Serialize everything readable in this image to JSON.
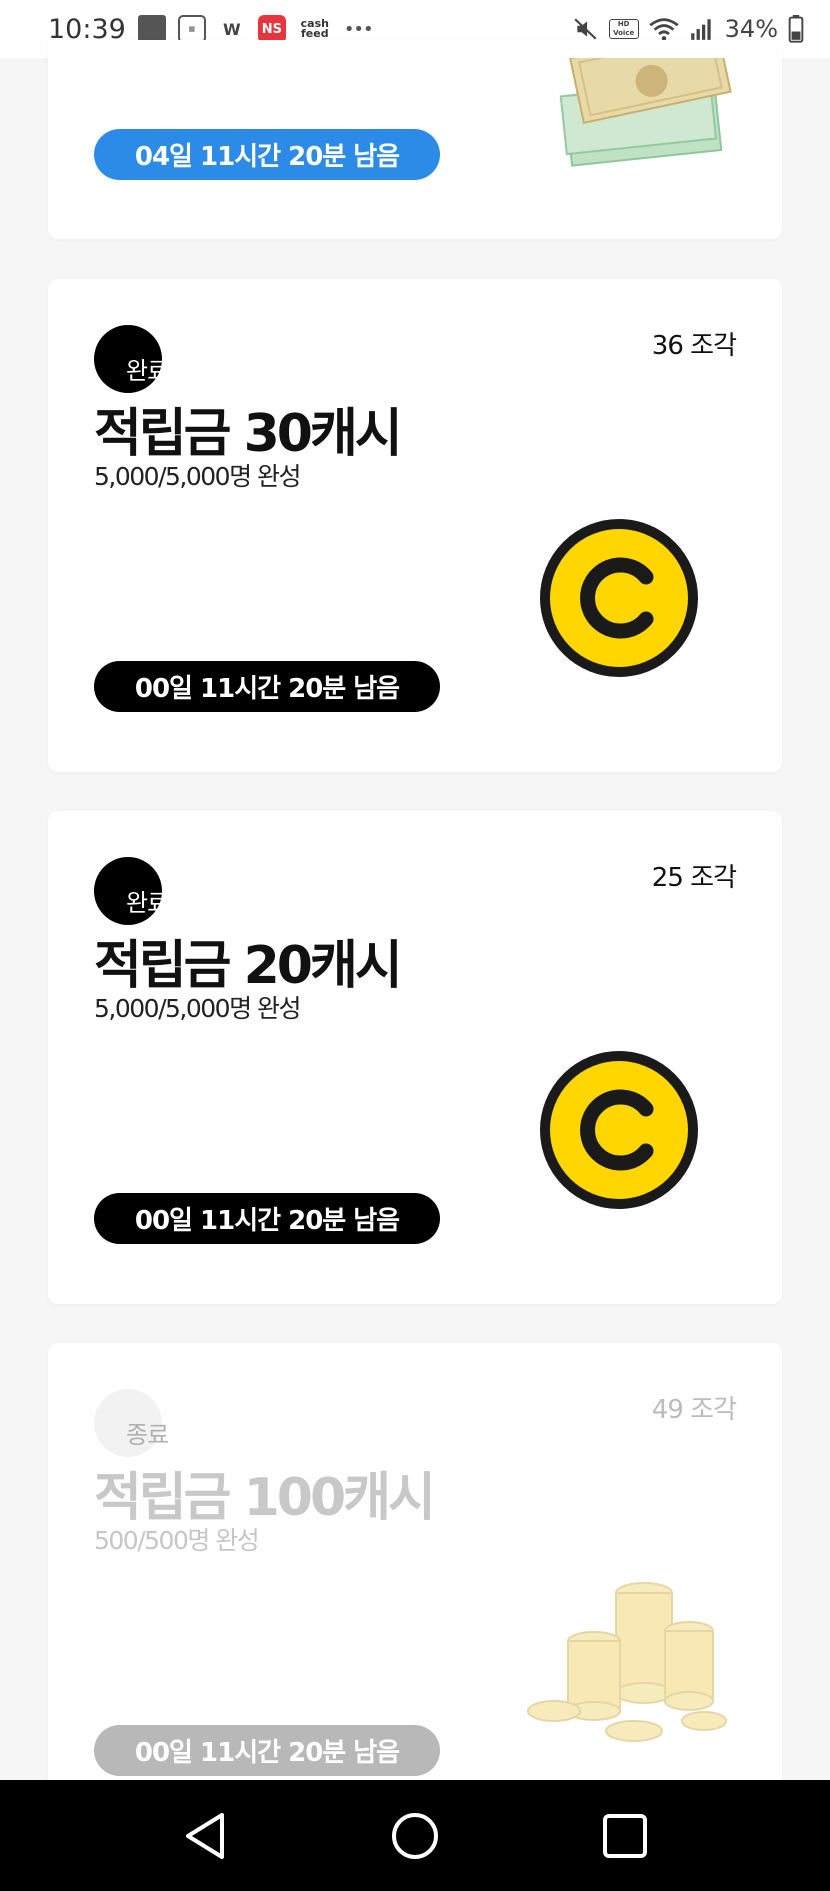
{
  "status_bar": {
    "time": "10:39",
    "notification_icons": [
      "gallery-icon",
      "store-app-icon",
      "w-app-icon",
      "ns-app-icon",
      "cashfeed-app-icon"
    ],
    "ns_label": "NS",
    "cashfeed_label": "cash feed",
    "more": "•••",
    "hd_label": "HD Voice",
    "battery_percent": "34%"
  },
  "cards": [
    {
      "timer": "04일 11시간 20분 남음",
      "timer_color": "#2d8be8",
      "image": "money-bills-icon"
    },
    {
      "status": "완료",
      "pieces": "36 조각",
      "title": "적립금 30캐시",
      "progress": "5,000/5,000명 완성",
      "timer": "00일 11시간 20분 남음",
      "image": "cash-coin-icon",
      "coin_color": "#ffd600"
    },
    {
      "status": "완료",
      "pieces": "25 조각",
      "title": "적립금 20캐시",
      "progress": "5,000/5,000명 완성",
      "timer": "00일 11시간 20분 남음",
      "image": "cash-coin-icon",
      "coin_color": "#ffd600"
    },
    {
      "status": "종료",
      "pieces": "49 조각",
      "title": "적립금 100캐시",
      "progress": "500/500명 완성",
      "timer": "00일 11시간 20분 남음",
      "image": "gold-coins-stack-icon"
    }
  ],
  "nav_bar": {
    "back": "back-icon",
    "home": "home-icon",
    "recents": "recents-icon"
  }
}
